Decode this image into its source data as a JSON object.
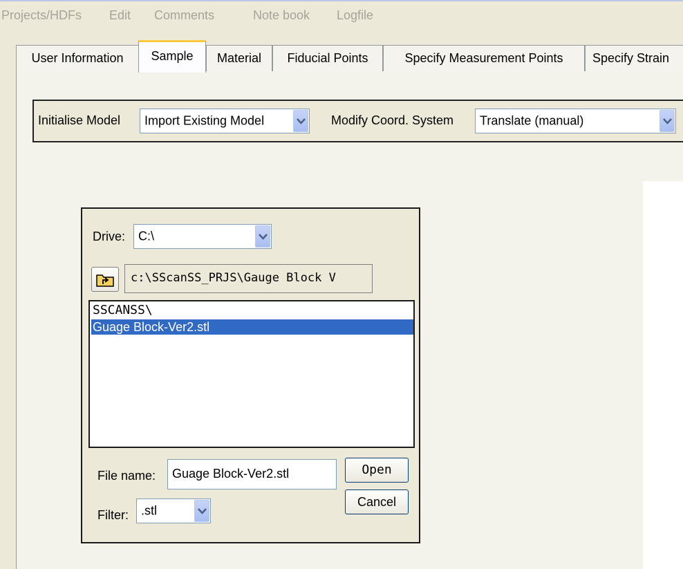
{
  "menu": [
    "Projects/HDFs",
    "Edit",
    "Comments",
    "Note book",
    "Logfile"
  ],
  "tabs": [
    {
      "label": "User Information",
      "active": false
    },
    {
      "label": "Sample",
      "active": true
    },
    {
      "label": "Material",
      "active": false
    },
    {
      "label": "Fiducial Points",
      "active": false
    },
    {
      "label": "Specify Measurement Points",
      "active": false
    },
    {
      "label": "Specify Strain",
      "active": false
    }
  ],
  "model": {
    "initialise_label": "Initialise Model",
    "initialise_value": "Import Existing Model",
    "coord_label": "Modify Coord. System",
    "coord_value": "Translate (manual)"
  },
  "dialog": {
    "drive_label": "Drive:",
    "drive_value": "C:\\",
    "path_value": "c:\\SScanSS_PRJS\\Gauge Block V",
    "folder_up_icon": "folder-up-icon",
    "list_items": [
      {
        "label": "SSCANSS\\",
        "selected": false
      },
      {
        "label": "Guage Block-Ver2.stl",
        "selected": true
      }
    ],
    "filename_label": "File name:",
    "filename_value": "Guage Block-Ver2.stl",
    "filter_label": "Filter:",
    "filter_value": ".stl",
    "open_label": "Open",
    "cancel_label": "Cancel"
  },
  "colors": {
    "selection": "#316ac5",
    "active_tab_accent": "#ffc83c",
    "window_bg": "#ece9d8"
  }
}
